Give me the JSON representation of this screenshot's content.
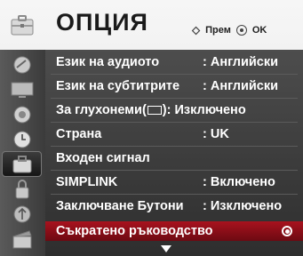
{
  "header": {
    "title": "ОПЦИЯ",
    "hint_move": "Прем",
    "hint_ok": "OK",
    "icon": "briefcase-option-icon"
  },
  "sidebar": {
    "items": [
      {
        "icon": "satellite-dish-icon"
      },
      {
        "icon": "tv-screen-icon"
      },
      {
        "icon": "speaker-icon"
      },
      {
        "icon": "clock-icon"
      },
      {
        "icon": "option-briefcase-icon",
        "active": true
      },
      {
        "icon": "lock-icon"
      },
      {
        "icon": "usb-icon"
      },
      {
        "icon": "film-clapper-icon"
      }
    ]
  },
  "menu": {
    "rows": [
      {
        "label": "Език на аудиото",
        "value": ": Английски"
      },
      {
        "label": "Език на субтитрите",
        "value": ": Английски"
      },
      {
        "label_before": "За глухонеми(",
        "label_after": "): Изключено"
      },
      {
        "label": "Страна",
        "value": ": UK"
      },
      {
        "label": "Входен сигнал",
        "value": ""
      },
      {
        "label": "SIMPLINK",
        "value": ": Включено"
      },
      {
        "label": "Заключване Бутони",
        "value": ": Изключено"
      },
      {
        "label": "Съкратено ръководство",
        "value": "",
        "selected": true
      }
    ]
  },
  "colors": {
    "selected_row": "#a8121e",
    "panel_bg": "#3d3d3d",
    "text": "#ffffff"
  }
}
